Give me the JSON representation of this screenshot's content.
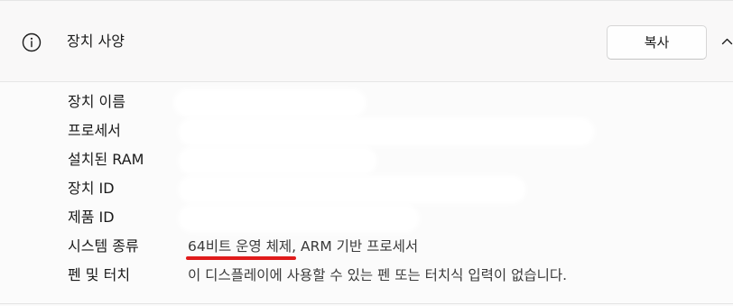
{
  "header": {
    "title": "장치 사양",
    "icon": "info-icon",
    "copy_label": "복사",
    "collapse_icon": "chevron-up-icon"
  },
  "specs": [
    {
      "label": "장치 이름",
      "value": ""
    },
    {
      "label": "프로세서",
      "value": ""
    },
    {
      "label": "설치된 RAM",
      "value": ""
    },
    {
      "label": "장치 ID",
      "value": ""
    },
    {
      "label": "제품 ID",
      "value": ""
    },
    {
      "label": "시스템 종류",
      "value": "64비트 운영 체제, ARM 기반 프로세서"
    },
    {
      "label": "펜 및 터치",
      "value": "이 디스플레이에 사용할 수 있는 펜 또는 터치식 입력이 없습니다."
    }
  ],
  "colors": {
    "highlight_underline": "#e01b1b",
    "background": "#fbfbfb"
  }
}
